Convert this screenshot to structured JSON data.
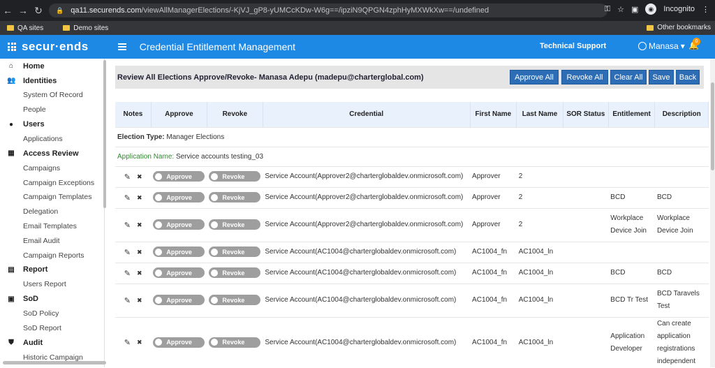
{
  "browser": {
    "url_host": "qa11.securends.com",
    "url_path": "/viewAllManagerElections/-KjVJ_gP8-yUMCcKDw-W6g==/ipziN9QPGN4zphHyMXWkXw==/undefined",
    "incognito_label": "Incognito",
    "bookmarks": [
      "QA sites",
      "Demo sites"
    ],
    "other_bookmarks": "Other bookmarks"
  },
  "header": {
    "logo": "secur·ends",
    "title": "Credential Entitlement Management",
    "tech_support": "Technical Support",
    "user": "Manasa",
    "notification_count": "0"
  },
  "sidebar": {
    "sections": [
      {
        "label": "Home",
        "icon": "home-icon",
        "items": []
      },
      {
        "label": "Identities",
        "icon": "people-icon",
        "items": [
          "System Of Record",
          "People"
        ]
      },
      {
        "label": "Users",
        "icon": "person-icon",
        "items": [
          "Applications"
        ]
      },
      {
        "label": "Access Review",
        "icon": "grid-icon",
        "items": [
          "Campaigns",
          "Campaign Exceptions",
          "Campaign Templates",
          "Delegation",
          "Email Templates",
          "Email Audit",
          "Campaign Reports"
        ]
      },
      {
        "label": "Report",
        "icon": "document-icon",
        "items": [
          "Users Report"
        ]
      },
      {
        "label": "SoD",
        "icon": "sod-icon",
        "items": [
          "SoD Policy",
          "SoD Report"
        ]
      },
      {
        "label": "Audit",
        "icon": "shield-icon",
        "items": [
          "Historic Campaign"
        ]
      }
    ]
  },
  "review": {
    "title": "Review All Elections Approve/Revoke- Manasa Adepu (madepu@charterglobal.com)",
    "buttons": [
      "Approve All",
      "Revoke All",
      "Clear All",
      "Save",
      "Back"
    ]
  },
  "table": {
    "columns": [
      "Notes",
      "Approve",
      "Revoke",
      "Credential",
      "First Name",
      "Last Name",
      "SOR Status",
      "Entitlement",
      "Description"
    ],
    "election_type_label": "Election Type:",
    "election_type_value": "Manager Elections",
    "application_name_label": "Application Name:",
    "application_name_value": "Service accounts testing_03",
    "approve_label": "Approve",
    "revoke_label": "Revoke",
    "rows": [
      {
        "credential": "Service Account(Approver2@charterglobaldev.onmicrosoft.com)",
        "first": "Approver",
        "last": "2",
        "sor": "",
        "entitlement": "",
        "description": ""
      },
      {
        "credential": "Service Account(Approver2@charterglobaldev.onmicrosoft.com)",
        "first": "Approver",
        "last": "2",
        "sor": "",
        "entitlement": "BCD",
        "description": "BCD"
      },
      {
        "credential": "Service Account(Approver2@charterglobaldev.onmicrosoft.com)",
        "first": "Approver",
        "last": "2",
        "sor": "",
        "entitlement": "Workplace Device Join",
        "description": "Workplace Device Join"
      },
      {
        "credential": "Service Account(AC1004@charterglobaldev.onmicrosoft.com)",
        "first": "AC1004_fn",
        "last": "AC1004_ln",
        "sor": "",
        "entitlement": "",
        "description": ""
      },
      {
        "credential": "Service Account(AC1004@charterglobaldev.onmicrosoft.com)",
        "first": "AC1004_fn",
        "last": "AC1004_ln",
        "sor": "",
        "entitlement": "BCD",
        "description": "BCD"
      },
      {
        "credential": "Service Account(AC1004@charterglobaldev.onmicrosoft.com)",
        "first": "AC1004_fn",
        "last": "AC1004_ln",
        "sor": "",
        "entitlement": "BCD Tr Test",
        "description": "BCD Taravels Test"
      },
      {
        "credential": "Service Account(AC1004@charterglobaldev.onmicrosoft.com)",
        "first": "AC1004_fn",
        "last": "AC1004_ln",
        "sor": "",
        "entitlement": "Application Developer",
        "description": "Can create application registrations independent"
      }
    ]
  }
}
